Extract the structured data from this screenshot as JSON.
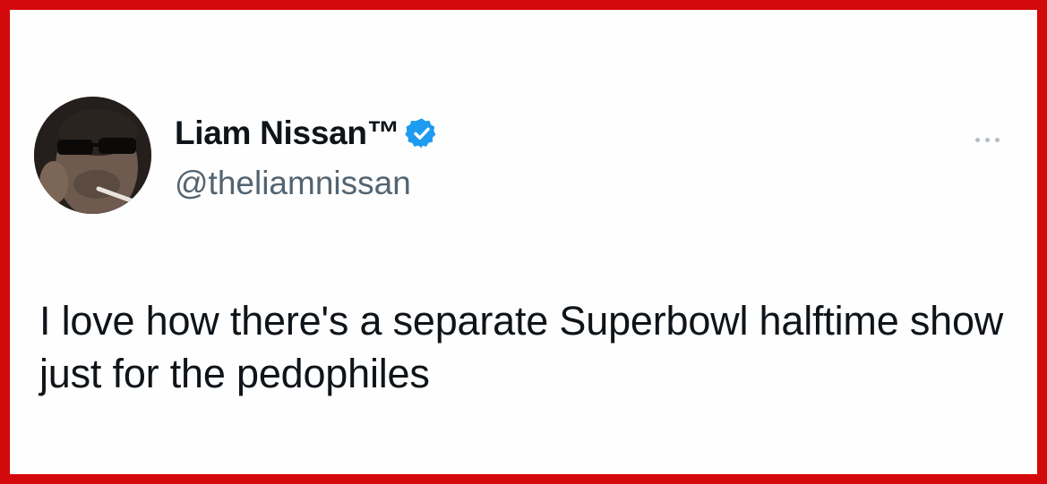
{
  "tweet": {
    "author": {
      "display_name": "Liam Nissan™",
      "handle": "@theliamnissan",
      "verified": true,
      "verified_color": "#1d9bf0",
      "avatar_icon": "profile-photo"
    },
    "more_icon": "ellipsis-icon",
    "text": "I love how there's a separate Superbowl halftime show just for the pedophiles"
  },
  "frame": {
    "border_color": "#d4090b"
  }
}
